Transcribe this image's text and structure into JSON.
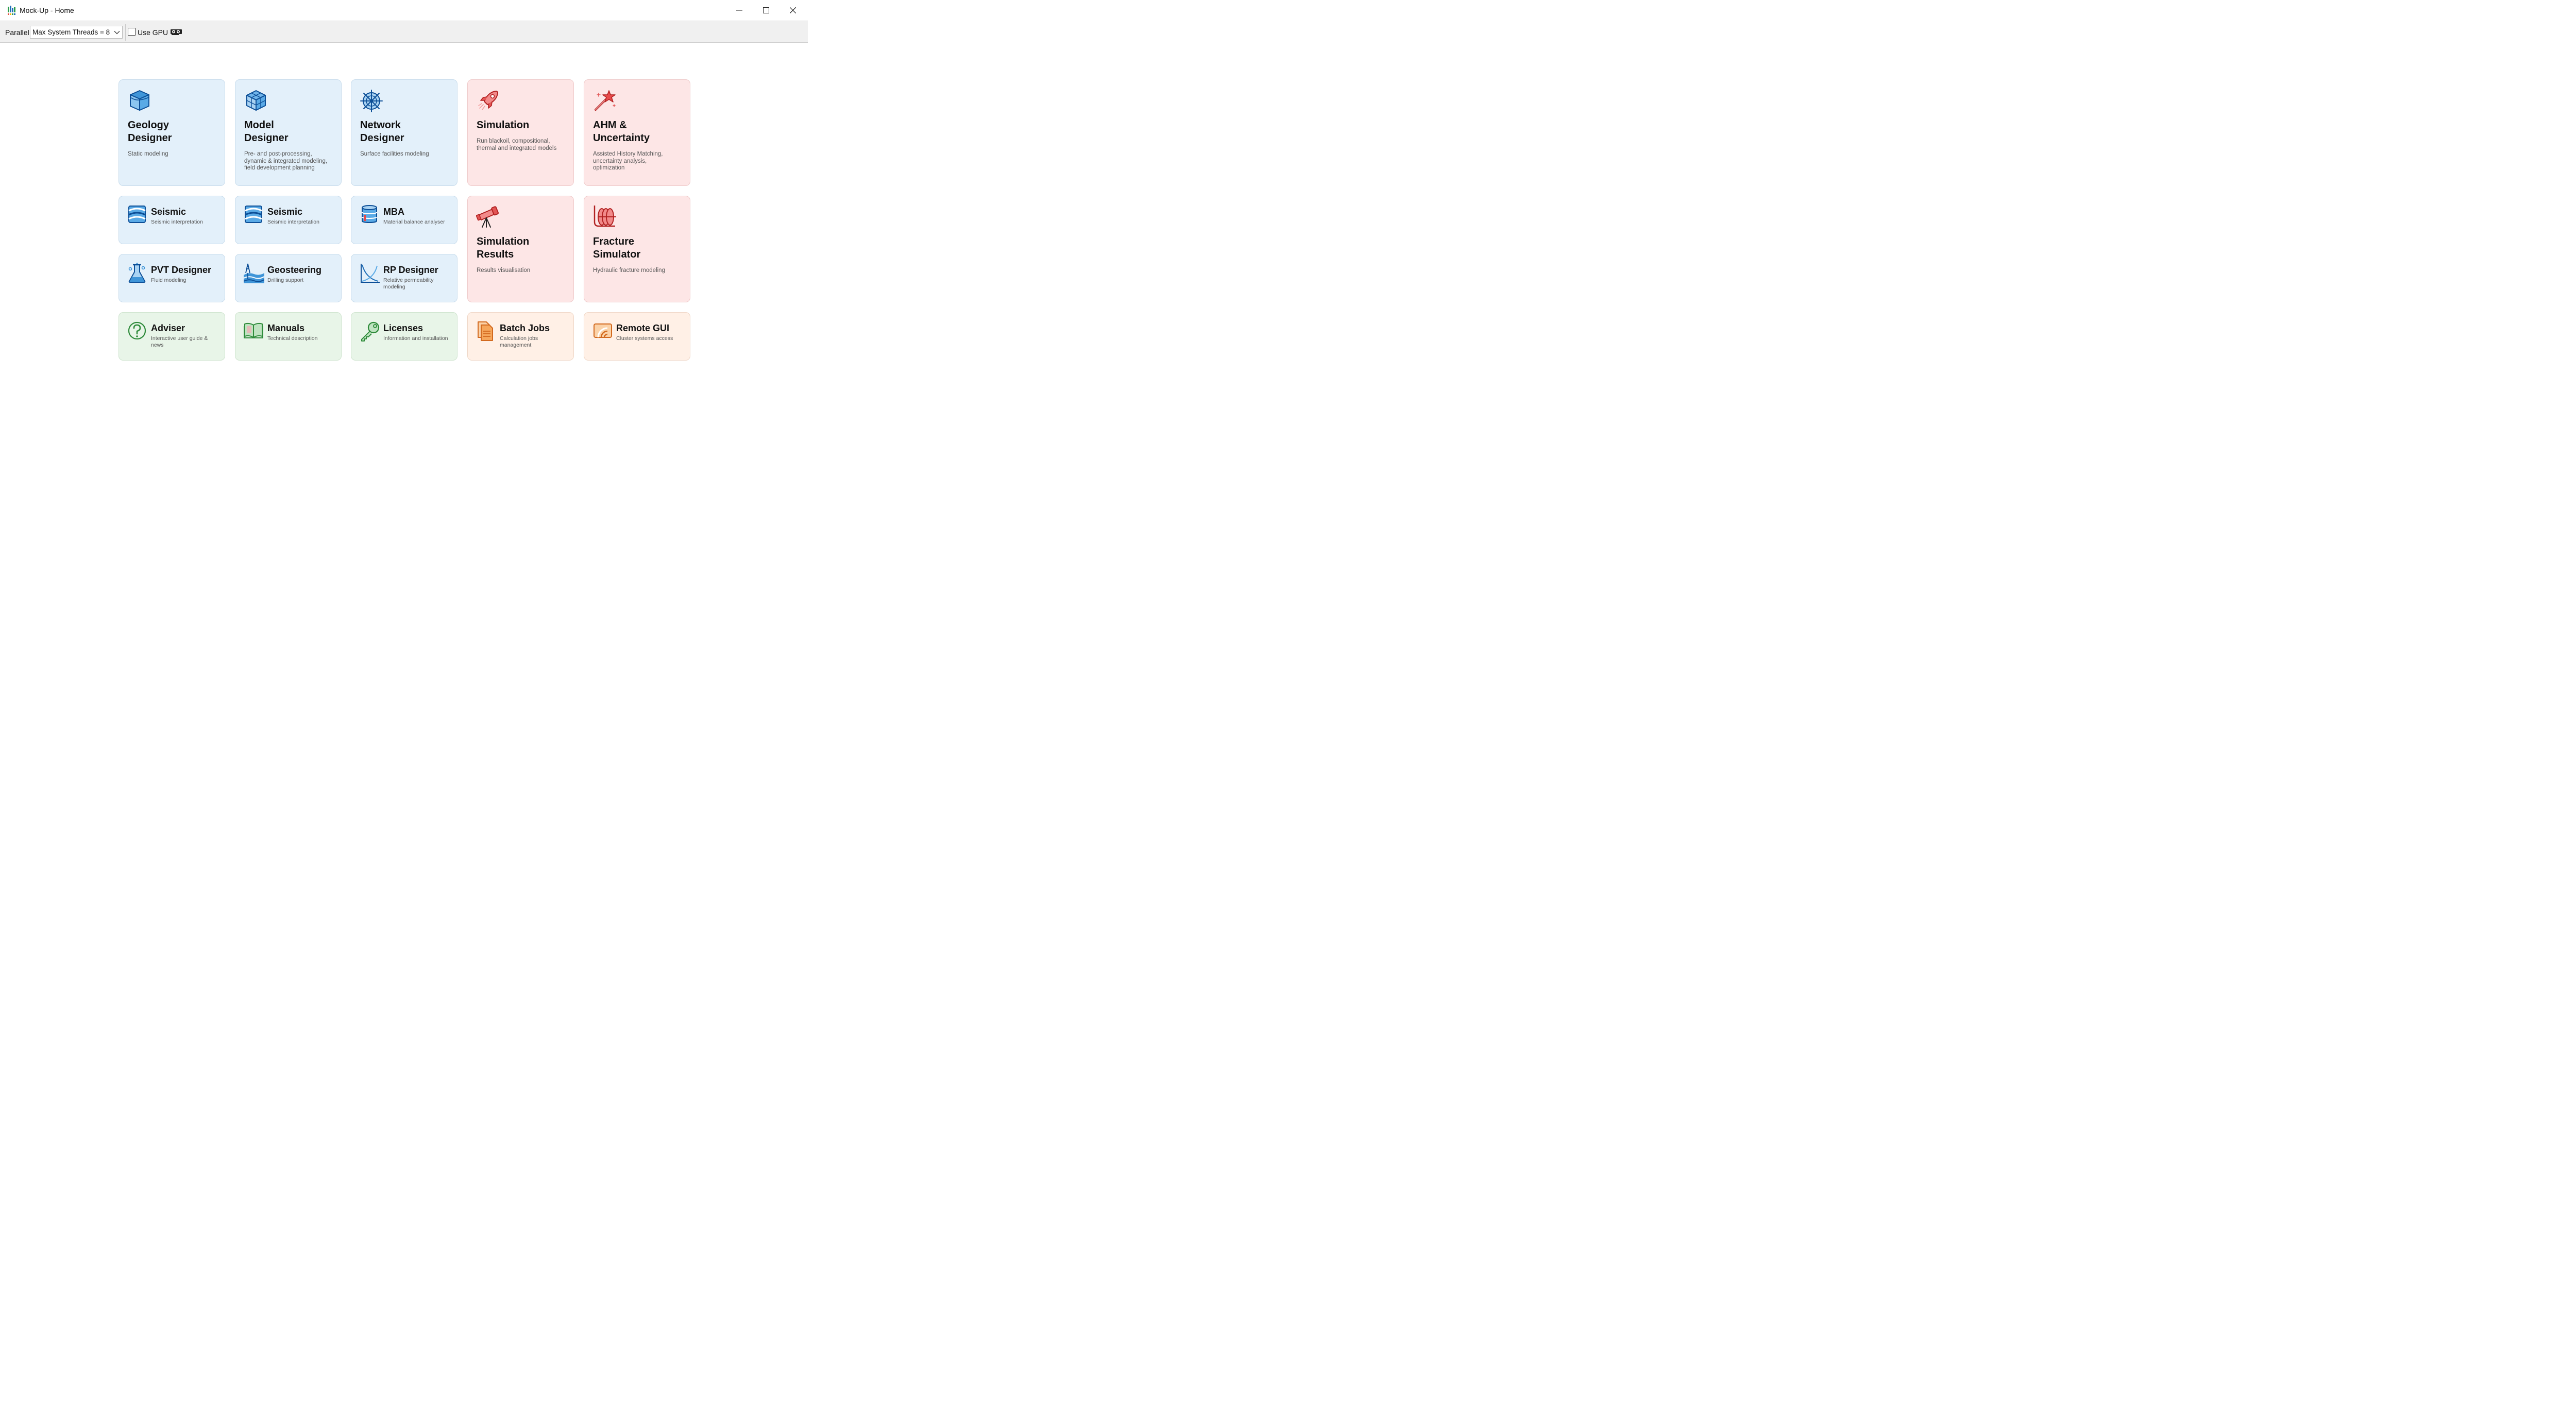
{
  "window": {
    "title": "Mock-Up - Home",
    "controls": {
      "minimize": "minimize",
      "maximize": "maximize",
      "close": "close"
    }
  },
  "toolbar": {
    "parallel_label": "Parallel",
    "threads_value": "Max System Threads = 8",
    "use_gpu_label": "Use GPU",
    "use_gpu_checked": false
  },
  "tiles": {
    "geology": {
      "title_line1": "Geology",
      "title_line2": "Designer",
      "desc": "Static modeling",
      "color": "#e3f0fa",
      "icon": "geology-box-icon"
    },
    "model": {
      "title_line1": "Model",
      "title_line2": "Designer",
      "desc_lines": [
        "Pre- and post-processing,",
        "dynamic & integrated modeling,",
        "field development planning"
      ],
      "color": "#e3f0fa",
      "icon": "cube-icon"
    },
    "network": {
      "title_line1": "Network",
      "title_line2": "Designer",
      "desc": "Surface facilities modeling",
      "color": "#e3f0fa",
      "icon": "network-wheel-icon"
    },
    "simulation": {
      "title_line1": "Simulation",
      "desc_lines": [
        "Run blackoil, compositional,",
        "thermal and integrated models"
      ],
      "color": "#fde6e6",
      "icon": "rocket-icon"
    },
    "ahm": {
      "title_line1": "AHM &",
      "title_line2": "Uncertainty",
      "desc_lines": [
        "Assisted History Matching,",
        "uncertainty analysis,",
        "optimization"
      ],
      "color": "#fde6e6",
      "icon": "magic-wand-icon"
    },
    "seismic1": {
      "title": "Seismic",
      "desc": "Seismic interpretation",
      "icon": "seismic-icon"
    },
    "seismic2": {
      "title": "Seismic",
      "desc": "Seismic interpretation",
      "icon": "seismic-icon"
    },
    "mba": {
      "title": "MBA",
      "desc": "Material balance analyser",
      "icon": "database-icon"
    },
    "simresults": {
      "title_line1": "Simulation",
      "title_line2": "Results",
      "desc": "Results visualisation",
      "icon": "telescope-icon"
    },
    "fracture": {
      "title_line1": "Fracture",
      "title_line2": "Simulator",
      "desc": "Hydraulic fracture modeling",
      "icon": "fracture-icon"
    },
    "pvt": {
      "title": "PVT Designer",
      "desc": "Fluid modeling",
      "icon": "flask-icon"
    },
    "geosteering": {
      "title": "Geosteering",
      "desc": "Drilling support",
      "icon": "drilling-rig-icon"
    },
    "rp": {
      "title": "RP Designer",
      "desc_lines": [
        "Relative permeability",
        "modeling"
      ],
      "icon": "curve-chart-icon"
    },
    "adviser": {
      "title": "Adviser",
      "desc_lines": [
        "Interactive user guide &",
        "news"
      ],
      "icon": "question-icon"
    },
    "manuals": {
      "title": "Manuals",
      "desc": "Technical description",
      "icon": "book-icon"
    },
    "licenses": {
      "title": "Licenses",
      "desc": "Information and installation",
      "icon": "key-icon"
    },
    "batch": {
      "title": "Batch Jobs",
      "desc_lines": [
        "Calculation jobs",
        "management"
      ],
      "icon": "documents-icon"
    },
    "remote": {
      "title": "Remote GUI",
      "desc": "Cluster systems access",
      "icon": "remote-signal-icon"
    }
  }
}
